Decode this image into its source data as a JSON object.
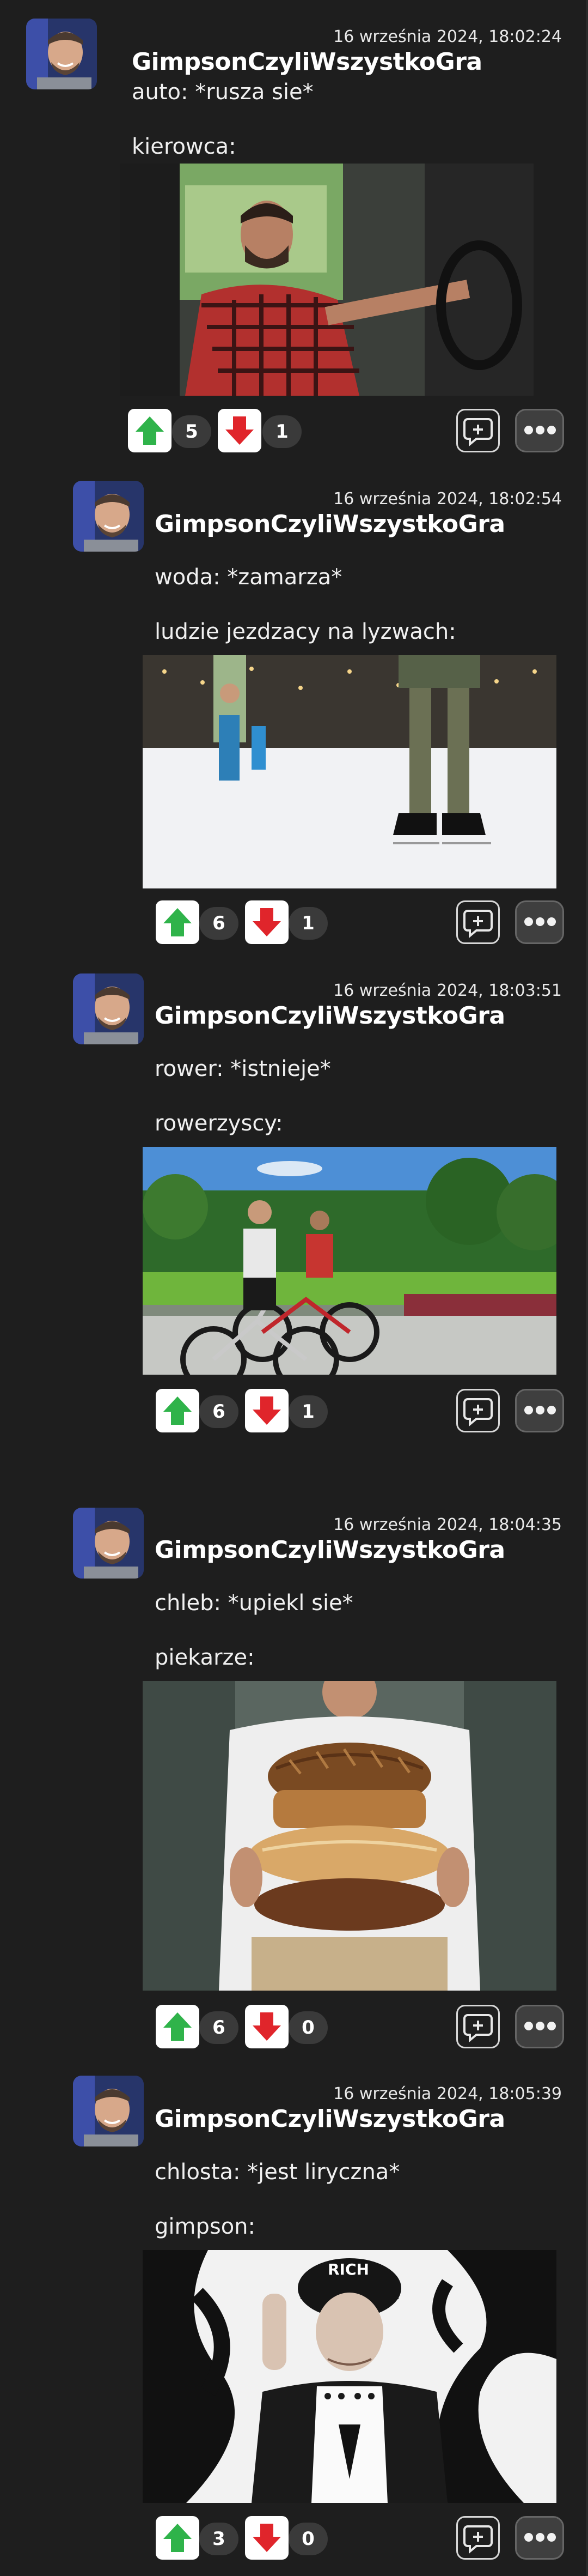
{
  "theme": {
    "background": "#1e1e1e",
    "upvote_color": "#2fb34a",
    "downvote_color": "#e0252b"
  },
  "posts": [
    {
      "date": "16 września 2024, 18:02:24",
      "author": "GimpsonCzyliWszystkoGra",
      "line1": "auto: *rusza sie*",
      "line2": "kierowca:",
      "image_alt": "man driving a car",
      "upvotes": "5",
      "downvotes": "1"
    },
    {
      "date": "16 września 2024, 18:02:54",
      "author": "GimpsonCzyliWszystkoGra",
      "line1": "woda: *zamarza*",
      "line2": "ludzie jezdzacy na lyzwach:",
      "image_alt": "people ice skating",
      "upvotes": "6",
      "downvotes": "1"
    },
    {
      "date": "16 września 2024, 18:03:51",
      "author": "GimpsonCzyliWszystkoGra",
      "line1": "rower: *istnieje*",
      "line2": "rowerzyscy:",
      "image_alt": "cyclists in a park",
      "upvotes": "6",
      "downvotes": "1"
    },
    {
      "date": "16 września 2024, 18:04:35",
      "author": "GimpsonCzyliWszystkoGra",
      "line1": "chleb: *upiekl sie*",
      "line2": "piekarze:",
      "image_alt": "baker holding bread",
      "upvotes": "6",
      "downvotes": "0"
    },
    {
      "date": "16 września 2024, 18:05:39",
      "author": "GimpsonCzyliWszystkoGra",
      "line1": "chlosta: *jest liryczna*",
      "line2": "gimpson:",
      "image_alt": "person in a cap and jacket",
      "upvotes": "3",
      "downvotes": "0"
    }
  ],
  "icons": {
    "upvote": "arrow-up-icon",
    "downvote": "arrow-down-icon",
    "quote": "quote-reply-icon",
    "more": "more-options-icon"
  }
}
